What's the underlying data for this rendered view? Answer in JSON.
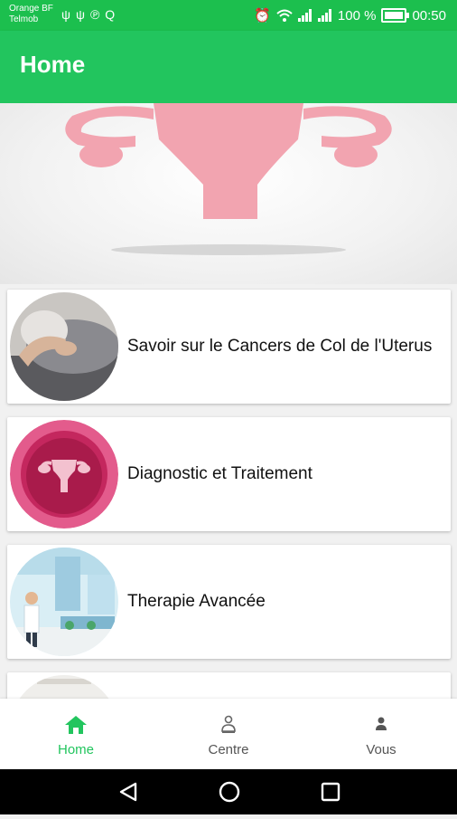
{
  "status_bar": {
    "carrier_line1": "Orange BF",
    "carrier_line2": "Telmob",
    "battery_percent": "100 %",
    "time": "00:50",
    "battery_level": 1.0,
    "left_icons": [
      "usb-icon",
      "usb-icon",
      "pinterest-icon",
      "search-app-icon"
    ],
    "right_icons": [
      "alarm-icon",
      "wifi-icon",
      "signal-icon",
      "signal-icon",
      "battery-icon"
    ]
  },
  "app_bar": {
    "title": "Home"
  },
  "hero": {
    "icon": "uterus-illustration",
    "color": "#f2a4b0"
  },
  "cards": [
    {
      "title": "Savoir sur le Cancers de Col de l'Uterus",
      "image": "woman-abdominal-pain-photo"
    },
    {
      "title": "Diagnostic et Traitement",
      "image": "uterus-pink-circle-icon"
    },
    {
      "title": "Therapie Avancée",
      "image": "doctor-hospital-illustration"
    },
    {
      "title": "",
      "image": "partial-card-image"
    }
  ],
  "bottom_nav": {
    "items": [
      {
        "label": "Home",
        "icon": "home-icon",
        "active": true
      },
      {
        "label": "Centre",
        "icon": "centre-icon",
        "active": false
      },
      {
        "label": "Vous",
        "icon": "person-icon",
        "active": false
      }
    ],
    "active_color": "#22c55e"
  },
  "system_nav": {
    "icons": [
      "back-icon",
      "home-circle-icon",
      "recents-icon"
    ]
  },
  "colors": {
    "primary": "#22c55e",
    "status": "#1cbf4e"
  }
}
